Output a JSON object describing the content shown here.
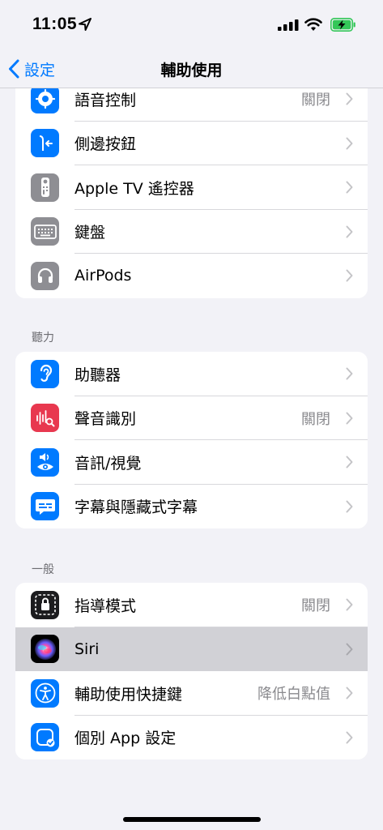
{
  "status": {
    "time": "11:05"
  },
  "nav": {
    "back_label": "設定",
    "title": "輔助使用"
  },
  "section1": {
    "items": [
      {
        "label": "語音控制",
        "value": "關閉",
        "icon": "voice-control-icon",
        "color": "#007aff"
      },
      {
        "label": "側邊按鈕",
        "value": "",
        "icon": "side-button-icon",
        "color": "#007aff"
      },
      {
        "label": "Apple TV 遙控器",
        "value": "",
        "icon": "apple-tv-remote-icon",
        "color": "#8e8e93"
      },
      {
        "label": "鍵盤",
        "value": "",
        "icon": "keyboard-icon",
        "color": "#8e8e93"
      },
      {
        "label": "AirPods",
        "value": "",
        "icon": "airpods-icon",
        "color": "#8e8e93"
      }
    ]
  },
  "section2": {
    "header": "聽力",
    "items": [
      {
        "label": "助聽器",
        "value": "",
        "icon": "hearing-ear-icon",
        "color": "#007aff"
      },
      {
        "label": "聲音識別",
        "value": "關閉",
        "icon": "sound-recognition-icon",
        "color": "#e8384f"
      },
      {
        "label": "音訊/視覺",
        "value": "",
        "icon": "audio-visual-icon",
        "color": "#007aff"
      },
      {
        "label": "字幕與隱藏式字幕",
        "value": "",
        "icon": "subtitles-icon",
        "color": "#007aff"
      }
    ]
  },
  "section3": {
    "header": "一般",
    "items": [
      {
        "label": "指導模式",
        "value": "關閉",
        "icon": "guided-access-icon",
        "color": "#1c1c1e"
      },
      {
        "label": "Siri",
        "value": "",
        "icon": "siri-icon",
        "color": "#000000"
      },
      {
        "label": "輔助使用快捷鍵",
        "value": "降低白點值",
        "icon": "accessibility-icon",
        "color": "#007aff"
      },
      {
        "label": "個別 App 設定",
        "value": "",
        "icon": "per-app-settings-icon",
        "color": "#007aff"
      }
    ]
  },
  "colors": {
    "accent": "#007aff",
    "battery": "#34c759"
  }
}
